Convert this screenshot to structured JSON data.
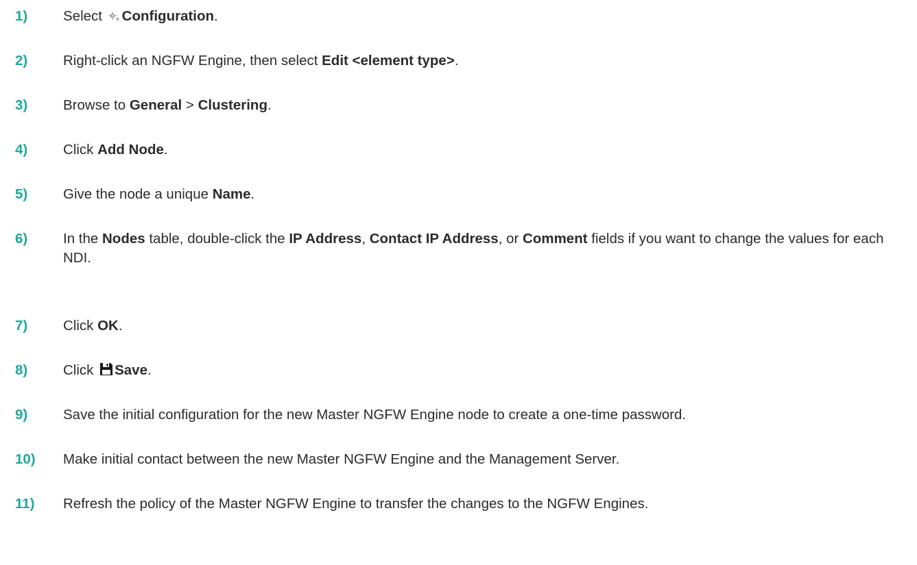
{
  "steps": [
    {
      "num": "1)",
      "parts": [
        {
          "t": "Select "
        },
        {
          "icon": "configuration-gear-icon"
        },
        {
          "t": "Configuration",
          "b": true
        },
        {
          "t": "."
        }
      ]
    },
    {
      "num": "2)",
      "parts": [
        {
          "t": "Right-click an NGFW Engine, then select "
        },
        {
          "t": "Edit <element type>",
          "b": true
        },
        {
          "t": "."
        }
      ]
    },
    {
      "num": "3)",
      "parts": [
        {
          "t": "Browse to "
        },
        {
          "t": "General",
          "b": true
        },
        {
          "t": " > "
        },
        {
          "t": "Clustering",
          "b": true
        },
        {
          "t": "."
        }
      ]
    },
    {
      "num": "4)",
      "parts": [
        {
          "t": "Click "
        },
        {
          "t": "Add Node",
          "b": true
        },
        {
          "t": "."
        }
      ]
    },
    {
      "num": "5)",
      "parts": [
        {
          "t": "Give the node a unique "
        },
        {
          "t": "Name",
          "b": true
        },
        {
          "t": "."
        }
      ]
    },
    {
      "num": "6)",
      "parts": [
        {
          "t": "In the "
        },
        {
          "t": "Nodes",
          "b": true
        },
        {
          "t": " table, double-click the "
        },
        {
          "t": "IP Address",
          "b": true
        },
        {
          "t": ", "
        },
        {
          "t": "Contact IP Address",
          "b": true
        },
        {
          "t": ", or "
        },
        {
          "t": "Comment",
          "b": true
        },
        {
          "t": " fields if you want to change the values for each NDI."
        }
      ]
    },
    {
      "num": "7)",
      "parts": [
        {
          "t": "Click "
        },
        {
          "t": "OK",
          "b": true
        },
        {
          "t": "."
        }
      ]
    },
    {
      "num": "8)",
      "parts": [
        {
          "t": "Click "
        },
        {
          "icon": "save-floppy-icon"
        },
        {
          "t": "Save",
          "b": true
        },
        {
          "t": "."
        }
      ]
    },
    {
      "num": "9)",
      "parts": [
        {
          "t": "Save the initial configuration for the new Master NGFW Engine node to create a one-time password."
        }
      ]
    },
    {
      "num": "10)",
      "parts": [
        {
          "t": "Make initial contact between the new Master NGFW Engine and the Management Server."
        }
      ]
    },
    {
      "num": "11)",
      "parts": [
        {
          "t": "Refresh the policy of the Master NGFW Engine to transfer the changes to the NGFW Engines."
        }
      ]
    }
  ],
  "colors": {
    "step_number": "#1fa89a",
    "text": "#2b2b2b",
    "icon_gray": "#9a9a9a"
  }
}
